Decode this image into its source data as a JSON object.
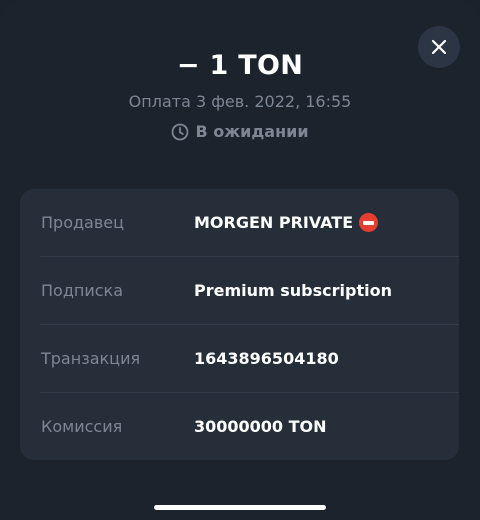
{
  "header": {
    "amount": "− 1 TON",
    "date": "Оплата 3 фев. 2022, 16:55",
    "status": "В ожидании",
    "status_icon": "clock-icon",
    "close_icon": "close-icon"
  },
  "details": {
    "rows": [
      {
        "label": "Продавец",
        "value": "MORGEN PRIVATE",
        "icon": "no-entry-icon"
      },
      {
        "label": "Подписка",
        "value": "Premium subscription"
      },
      {
        "label": "Транзакция",
        "value": "1643896504180"
      },
      {
        "label": "Комиссия",
        "value": "30000000 TON"
      }
    ]
  },
  "colors": {
    "background": "#1c232d",
    "card": "#262e3a",
    "muted_text": "#7d8794",
    "no_entry_red": "#e63f32"
  }
}
